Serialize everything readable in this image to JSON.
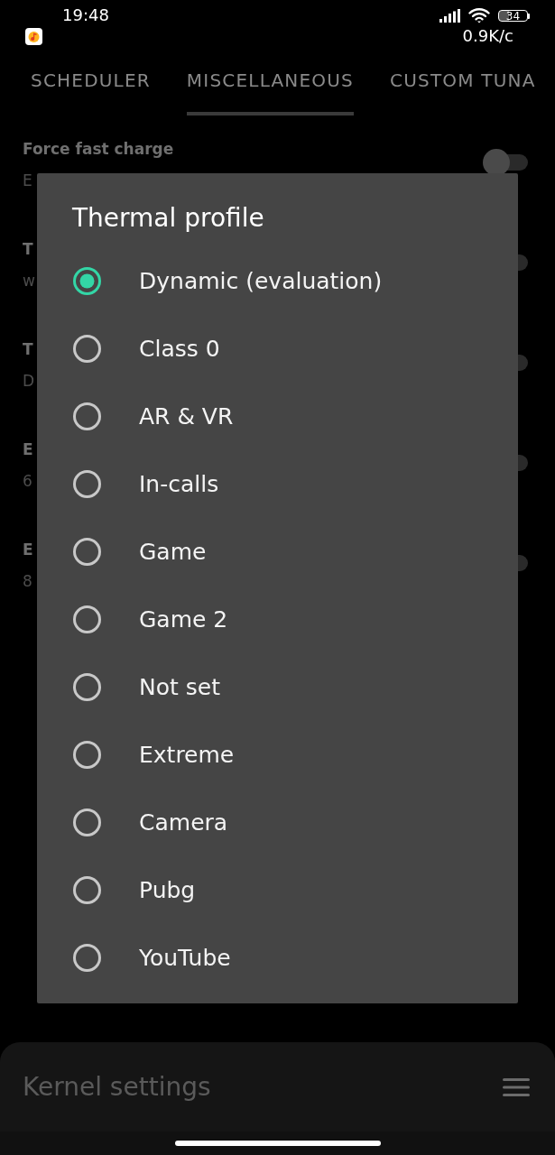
{
  "status_bar": {
    "time": "19:48",
    "battery": "34",
    "network_speed": "0.9K/c"
  },
  "tabs": [
    {
      "label": "SCHEDULER",
      "selected": false
    },
    {
      "label": "MISCELLANEOUS",
      "selected": true
    },
    {
      "label": "CUSTOM TUNA",
      "selected": false
    }
  ],
  "settings": [
    {
      "title": "Force fast charge",
      "value": "E",
      "on": false
    },
    {
      "title": "T",
      "value": "w",
      "on": false
    },
    {
      "title": "T",
      "value": "D",
      "on": false
    },
    {
      "title": "E",
      "value": "6",
      "on": false
    },
    {
      "title": "E",
      "value": "8",
      "on": false
    }
  ],
  "dialog": {
    "title": "Thermal profile",
    "options": [
      {
        "label": "Dynamic (evaluation)",
        "selected": true
      },
      {
        "label": "Class 0",
        "selected": false
      },
      {
        "label": "AR & VR",
        "selected": false
      },
      {
        "label": "In-calls",
        "selected": false
      },
      {
        "label": "Game",
        "selected": false
      },
      {
        "label": "Game 2",
        "selected": false
      },
      {
        "label": "Not set",
        "selected": false
      },
      {
        "label": "Extreme",
        "selected": false
      },
      {
        "label": "Camera",
        "selected": false
      },
      {
        "label": "Pubg",
        "selected": false
      },
      {
        "label": "YouTube",
        "selected": false
      }
    ]
  },
  "bottom_bar": {
    "title": "Kernel settings"
  }
}
